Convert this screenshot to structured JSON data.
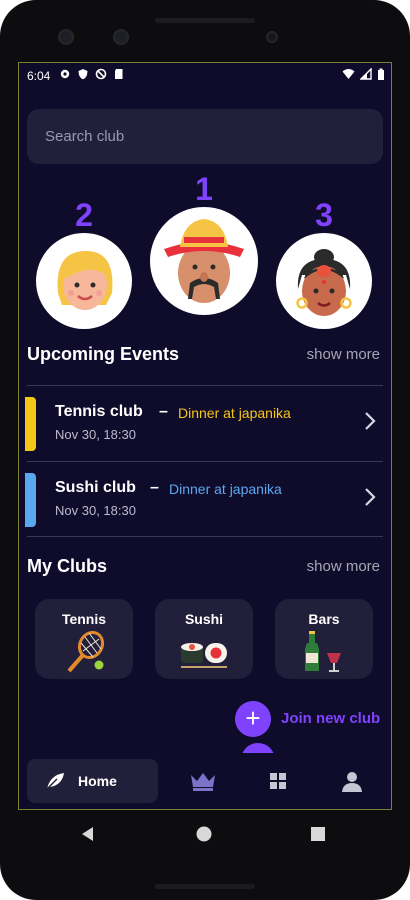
{
  "status_bar": {
    "time": "6:04",
    "left_icons": [
      "gear-icon",
      "shield-icon",
      "circle-slash-icon",
      "sd-card-icon"
    ],
    "right_icons": [
      "wifi-icon",
      "signal-icon",
      "battery-icon"
    ]
  },
  "search": {
    "placeholder": "Search club"
  },
  "leaderboard": [
    {
      "rank": "2",
      "avatar": "blonde-woman-avatar"
    },
    {
      "rank": "1",
      "avatar": "sombrero-man-avatar"
    },
    {
      "rank": "3",
      "avatar": "dark-hair-woman-avatar"
    }
  ],
  "upcoming": {
    "title": "Upcoming Events",
    "show_more": "show more",
    "events": [
      {
        "club": "Tennis club",
        "dash": "–",
        "subtitle": "Dinner at japanika",
        "date": "Nov 30, 18:30",
        "color": "#f5c518"
      },
      {
        "club": "Sushi club",
        "dash": "–",
        "subtitle": "Dinner at japanika",
        "date": "Nov 30, 18:30",
        "color": "#5aa9f0"
      }
    ]
  },
  "clubs": {
    "title": "My Clubs",
    "show_more": "show more",
    "items": [
      {
        "label": "Tennis",
        "icon": "tennis-racket-icon"
      },
      {
        "label": "Sushi",
        "icon": "sushi-icon"
      },
      {
        "label": "Bars",
        "icon": "wine-bottle-icon"
      }
    ]
  },
  "join": {
    "icon": "+",
    "label": "Join new club"
  },
  "nav": {
    "home_label": "Home",
    "items": [
      "home-leaf-icon",
      "crown-icon",
      "grid-icon",
      "person-icon"
    ]
  },
  "colors": {
    "background": "#0f0b2a",
    "card": "#221f3a",
    "accent": "#7f43ff",
    "tennis": "#f5c518",
    "sushi": "#5aa9f0"
  }
}
